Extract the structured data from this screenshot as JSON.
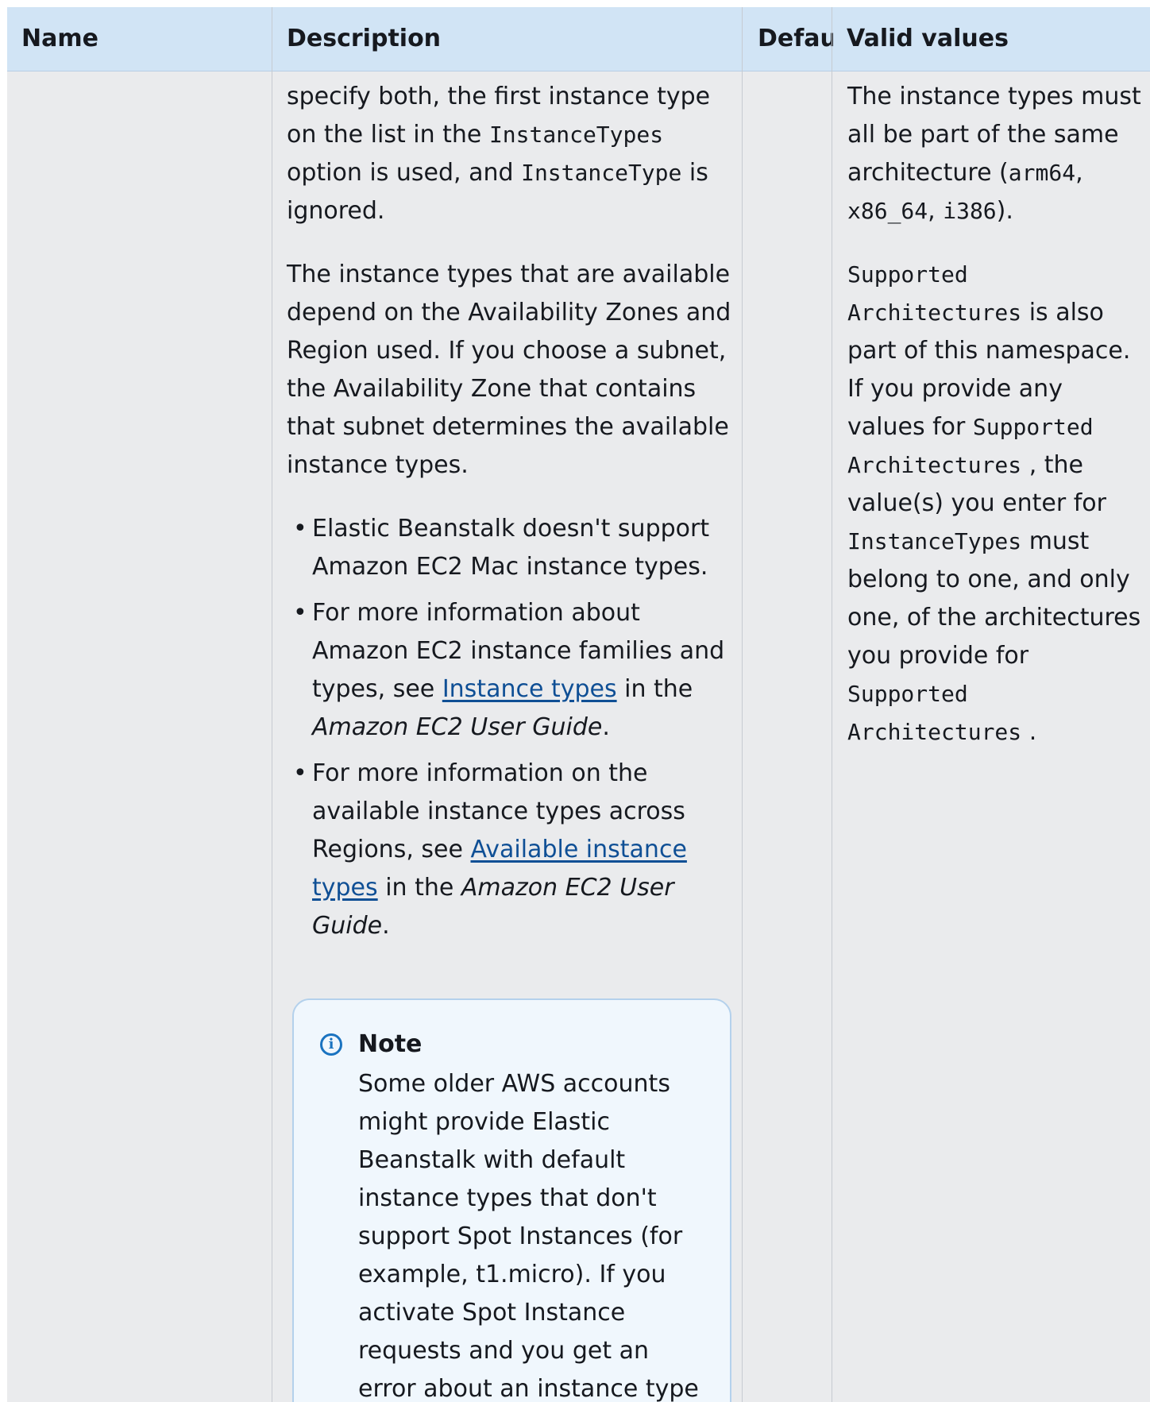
{
  "headers": {
    "name": "Name",
    "description": "Description",
    "default": "Defaul",
    "valid_values": "Valid values"
  },
  "description": {
    "p1_a": "specify both, the first instance type on the list in the ",
    "p1_code1": "InstanceTypes",
    "p1_b": " option is used, and ",
    "p1_code2": "InstanceType",
    "p1_c": " is ignored.",
    "p2": "The instance types that are available depend on the Availability Zones and Region used. If you choose a subnet, the Availability Zone that contains that subnet determines the available instance types.",
    "bullet1": "Elastic Beanstalk doesn't support Amazon EC2 Mac instance types.",
    "bullet2_a": "For more information about Amazon EC2 instance families and types, see ",
    "bullet2_link": "Instance types",
    "bullet2_b": " in the ",
    "bullet2_em": "Amazon EC2 User Guide",
    "bullet2_c": ".",
    "bullet3_a": "For more information on the available instance types across Regions, see ",
    "bullet3_link": "Available instance types",
    "bullet3_b": " in the ",
    "bullet3_em": "Amazon EC2 User Guide",
    "bullet3_c": "."
  },
  "note": {
    "icon": "info-icon",
    "icon_glyph": "i",
    "title": "Note",
    "body": "Some older AWS accounts might provide Elastic Beanstalk with default instance types that don't support Spot Instances (for example, t1.micro). If you activate Spot Instance requests and you get an error about an instance type that"
  },
  "valid_values": {
    "p1_a": "The instance types must all be part of the same architecture (",
    "p1_code1": "arm64",
    "p1_b": ", ",
    "p1_code2": "x86_64",
    "p1_c": ", ",
    "p1_code3": "i386",
    "p1_d": ").",
    "p2_code1": "Supported Architectures",
    "p2_a": " is also part of this namespace. If you provide any values for ",
    "p2_code2": "Supported Architectures",
    "p2_b": " , the value(s) you enter for ",
    "p2_code3": "InstanceTypes",
    "p2_c": " must belong to one, and only one, of the architectures you provide for ",
    "p2_code4": "Supported Architectures",
    "p2_d": " ."
  }
}
